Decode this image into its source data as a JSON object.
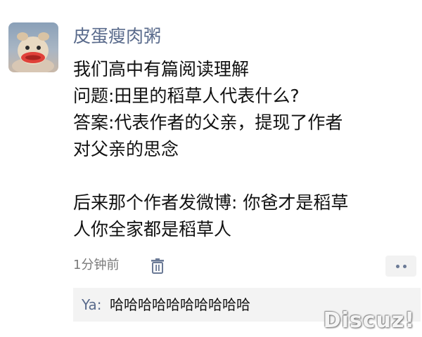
{
  "post": {
    "username": "皮蛋瘦肉粥",
    "lines": [
      "我们高中有篇阅读理解",
      "问题:田里的稻草人代表什么?",
      "答案:代表作者的父亲，提现了作者",
      "对父亲的思念",
      "",
      "后来那个作者发微博: 你爸才是稻草",
      "人你全家都是稻草人"
    ],
    "timestamp": "1分钟前"
  },
  "comment": {
    "author": "Ya:",
    "text": "哈哈哈哈哈哈哈哈哈哈"
  },
  "watermark": "Discuz!",
  "icons": {
    "delete": "trash-icon",
    "more": "more-dots-icon"
  },
  "colors": {
    "name": "#5a6b8c",
    "meta": "#7a7a7a",
    "comment_bg": "#f3f3f3"
  }
}
